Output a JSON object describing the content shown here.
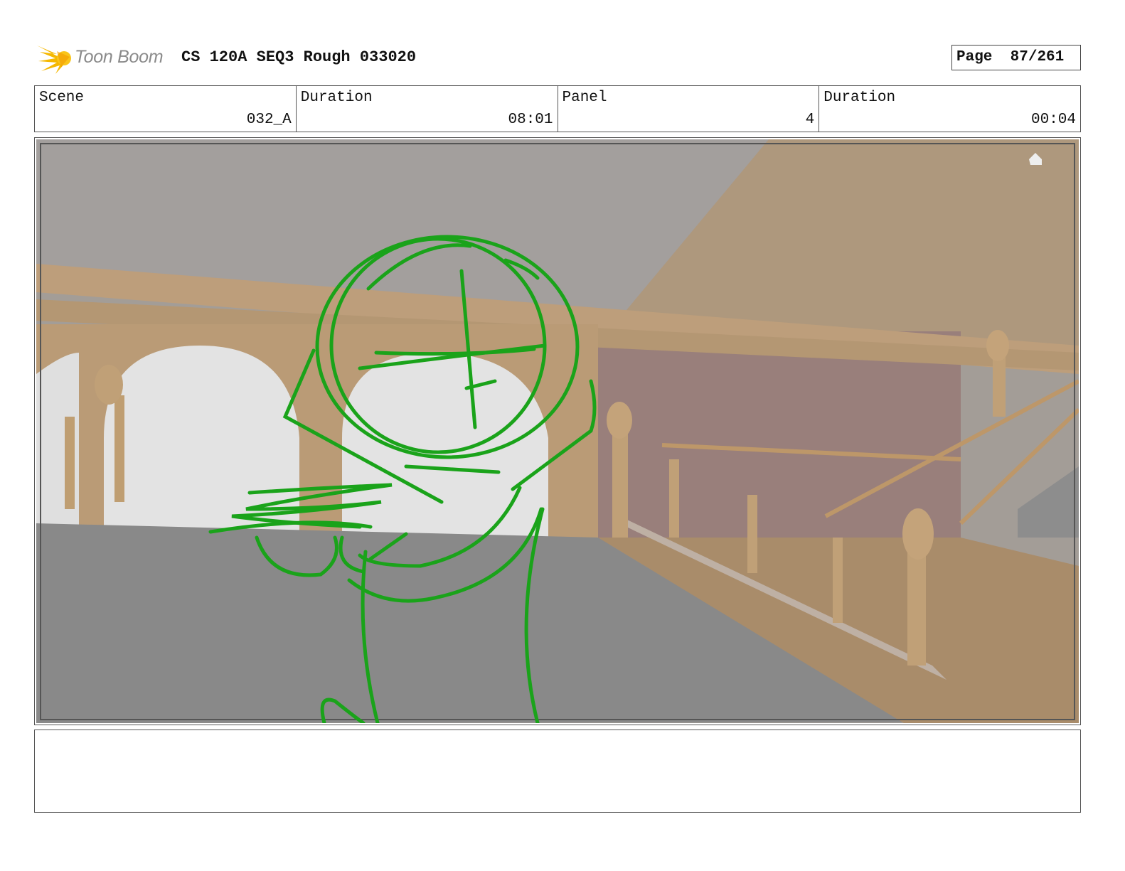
{
  "header": {
    "logo_text": "Toon Boom",
    "title": "CS 120A SEQ3 Rough 033020",
    "page_label": "Page",
    "page_number": "87/261"
  },
  "info": {
    "scene_label": "Scene",
    "scene_value": "032_A",
    "duration_label": "Duration",
    "duration_value": "08:01",
    "panel_label": "Panel",
    "panel_value": "4",
    "panel_duration_label": "Duration",
    "panel_duration_value": "00:04"
  },
  "notes": {
    "text": ""
  },
  "colors": {
    "sketch": "#1aa31a",
    "logo_star": "#f5b800"
  }
}
